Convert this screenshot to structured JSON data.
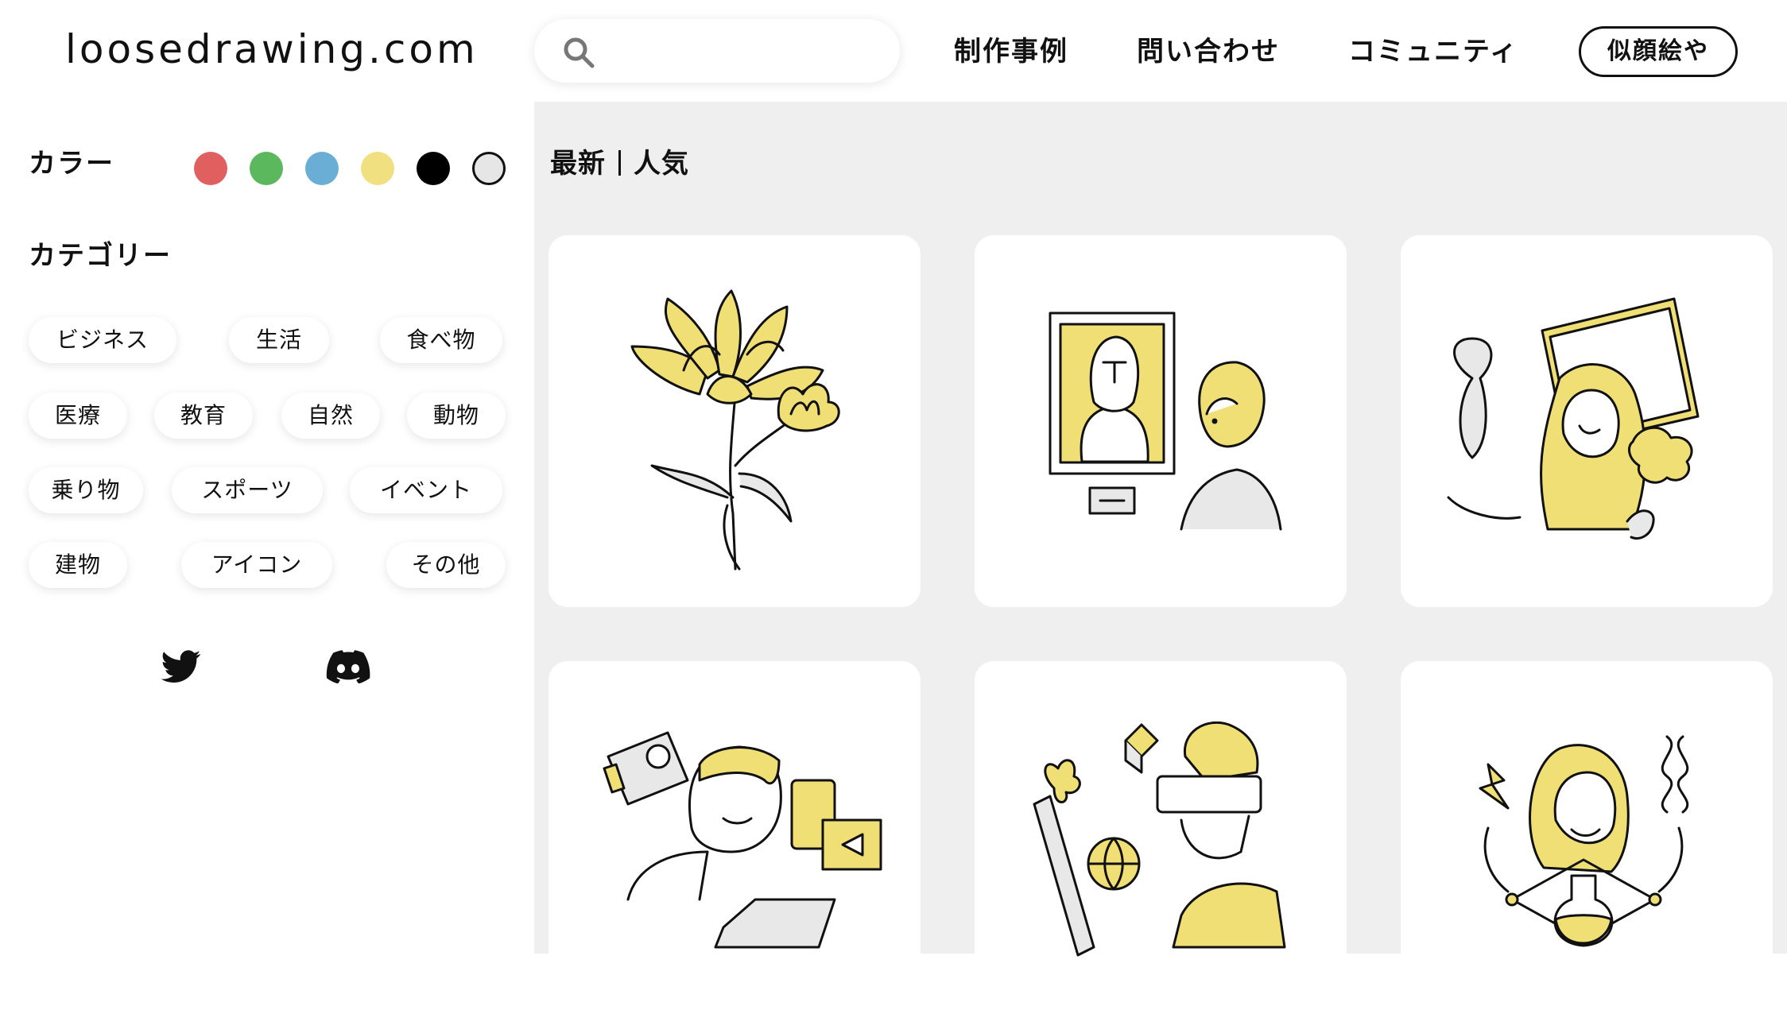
{
  "header": {
    "logo": "loosedrawing.com",
    "search": {
      "placeholder": "",
      "value": "",
      "icon": "search-icon"
    },
    "nav": [
      {
        "label": "制作事例"
      },
      {
        "label": "問い合わせ"
      },
      {
        "label": "コミュニティ"
      }
    ],
    "cta_button": "似顔絵や"
  },
  "sidebar": {
    "color_title": "カラー",
    "colors": [
      {
        "name": "red",
        "hex": "#e06060"
      },
      {
        "name": "green",
        "hex": "#5cb85c"
      },
      {
        "name": "blue",
        "hex": "#6aaed6"
      },
      {
        "name": "yellow",
        "hex": "#f0e080"
      },
      {
        "name": "black",
        "hex": "#000000"
      },
      {
        "name": "white",
        "hex": "#e6e6e6"
      }
    ],
    "category_title": "カテゴリー",
    "categories": [
      "ビジネス",
      "生活",
      "食べ物",
      "医療",
      "教育",
      "自然",
      "動物",
      "乗り物",
      "スポーツ",
      "イベント",
      "建物",
      "アイコン",
      "その他"
    ],
    "social": [
      {
        "name": "twitter-icon"
      },
      {
        "name": "discord-icon"
      }
    ]
  },
  "main": {
    "sort": {
      "latest": "最新",
      "popular": "人気"
    },
    "cards": [
      {
        "subject": "chrysanthemum flowers"
      },
      {
        "subject": "person viewing painting"
      },
      {
        "subject": "woman with museum art"
      },
      {
        "subject": "man with video camera and laptop"
      },
      {
        "subject": "man with VR headset"
      },
      {
        "subject": "woman scientist with flask and DNA"
      }
    ],
    "accent": "#f0df74"
  }
}
